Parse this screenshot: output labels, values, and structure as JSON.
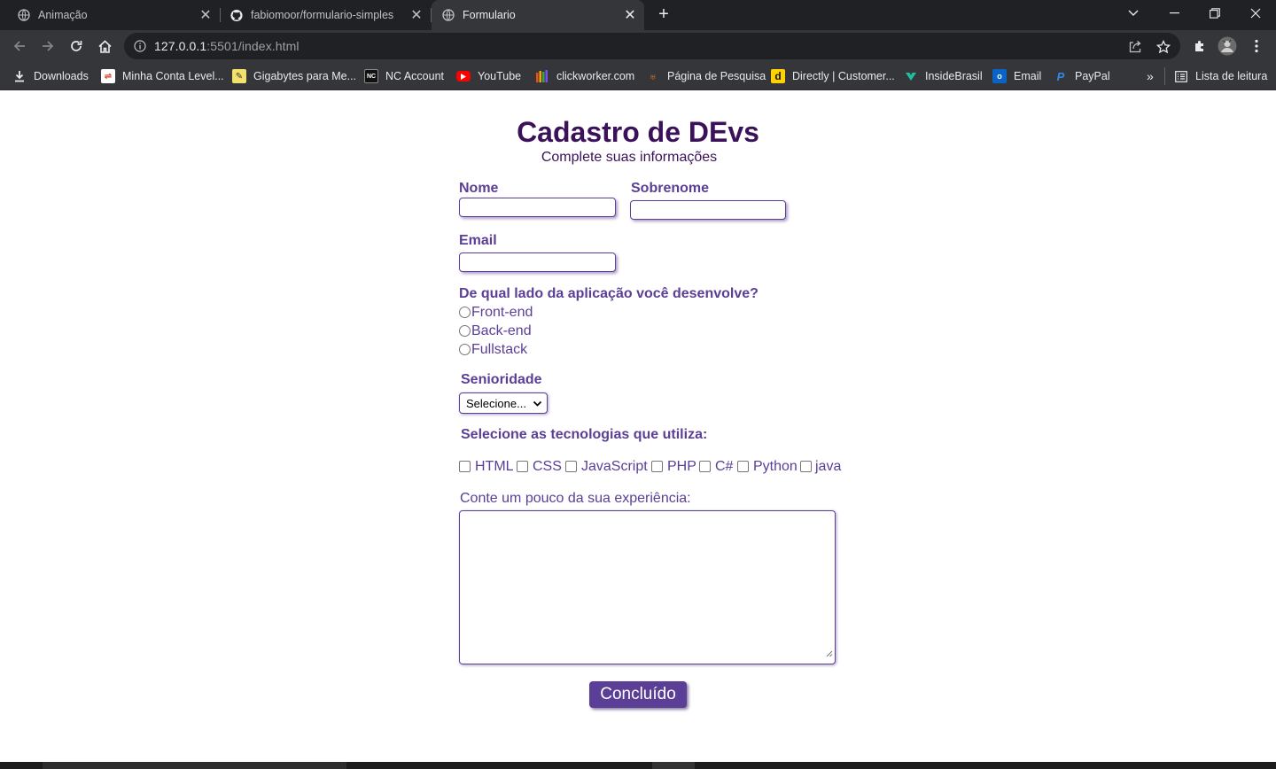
{
  "browser": {
    "tabs": [
      {
        "title": "Animação",
        "active": false
      },
      {
        "title": "fabiomoor/formulario-simples",
        "active": false
      },
      {
        "title": "Formulario",
        "active": true
      }
    ],
    "url_host": "127.0.0.1",
    "url_rest": ":5501/index.html",
    "bookmarks": [
      {
        "label": "Downloads",
        "icon": "download-icon"
      },
      {
        "label": "Minha Conta Level...",
        "icon": "level-icon"
      },
      {
        "label": "Gigabytes para Me...",
        "icon": "gigabytes-icon"
      },
      {
        "label": "NC Account",
        "icon": "nc-icon"
      },
      {
        "label": "YouTube",
        "icon": "youtube-icon"
      },
      {
        "label": "clickworker.com",
        "icon": "clickworker-icon"
      },
      {
        "label": "Página de Pesquisa",
        "icon": "pesquisa-icon"
      },
      {
        "label": "Directly | Customer...",
        "icon": "directly-icon"
      },
      {
        "label": "InsideBrasil",
        "icon": "insidebrasil-icon"
      },
      {
        "label": "Email",
        "icon": "outlook-icon"
      },
      {
        "label": "PayPal",
        "icon": "paypal-icon"
      }
    ],
    "bookmarks_overflow": "»",
    "reading_list": "Lista de leitura"
  },
  "form": {
    "title": "Cadastro de DEvs",
    "subtitle": "Complete suas informações",
    "nome_label": "Nome",
    "sobrenome_label": "Sobrenome",
    "email_label": "Email",
    "side_question": "De qual lado da aplicação você desenvolve?",
    "side_options": [
      "Front-end",
      "Back-end",
      "Fullstack"
    ],
    "seniority_label": "Senioridade",
    "seniority_selected": "Selecione...",
    "tech_label": "Selecione as tecnologias que utiliza:",
    "tech_options": [
      "HTML",
      "CSS",
      "JavaScript",
      "PHP",
      "C#",
      "Python",
      "java"
    ],
    "experience_label": "Conte um pouco da sua experiência:",
    "submit_label": "Concluído"
  },
  "colors": {
    "heading": "#3b1259",
    "label": "#5b3e96",
    "button_bg": "#5b3e96"
  }
}
